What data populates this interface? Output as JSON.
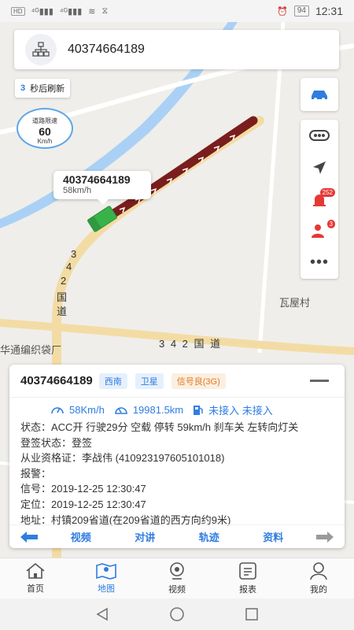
{
  "status_bar": {
    "left_icons": [
      "hd-icon",
      "signal-4g-icon",
      "signal-4g-icon",
      "wifi-icon",
      "hourglass-icon"
    ],
    "battery": "94",
    "time": "12:31"
  },
  "device": {
    "number": "40374664189"
  },
  "refresh": {
    "seconds": "3",
    "text": "秒后刷新"
  },
  "speed_limit": {
    "title": "道路限速",
    "value": "60",
    "unit": "Km/h"
  },
  "map": {
    "labels": {
      "village": "瓦屋村",
      "factory": "华通编织袋厂",
      "road_vertical": [
        "3",
        "4",
        "2",
        "国",
        "道"
      ],
      "road_horizontal": "3 4 2 国 道"
    },
    "colors": {
      "road": "#f3dca4",
      "river": "#aad1f5",
      "track": "#7a1d1d",
      "vehicle": "#38b34a"
    }
  },
  "bubble": {
    "title": "40374664189",
    "speed": "58km/h"
  },
  "right_tools": {
    "alarm_badge": "252",
    "person_badge": "3"
  },
  "card": {
    "title": "40374664189",
    "tags": [
      "西南",
      "卫星",
      "信号良(3G)"
    ],
    "speed": "58Km/h",
    "mileage": "19981.5km",
    "fuel": "未接入 未接入",
    "lines": [
      "状态：ACC开 行驶29分 空载 停转 59km/h 刹车关 左转向灯关",
      "登签状态：登签",
      "从业资格证：李战伟 (410923197605101018)",
      "报警：",
      "信号：2019-12-25 12:30:47",
      "定位：2019-12-25 12:30:47",
      "地址：村镇209省道(在209省道的西方向约9米)"
    ],
    "actions": [
      "视频",
      "对讲",
      "轨迹",
      "资料"
    ]
  },
  "tabs": [
    {
      "label": "首页",
      "icon": "home-icon"
    },
    {
      "label": "地图",
      "icon": "map-icon"
    },
    {
      "label": "视频",
      "icon": "camera-icon"
    },
    {
      "label": "报表",
      "icon": "report-icon"
    },
    {
      "label": "我的",
      "icon": "user-icon"
    }
  ],
  "accent": "#2f7de1"
}
